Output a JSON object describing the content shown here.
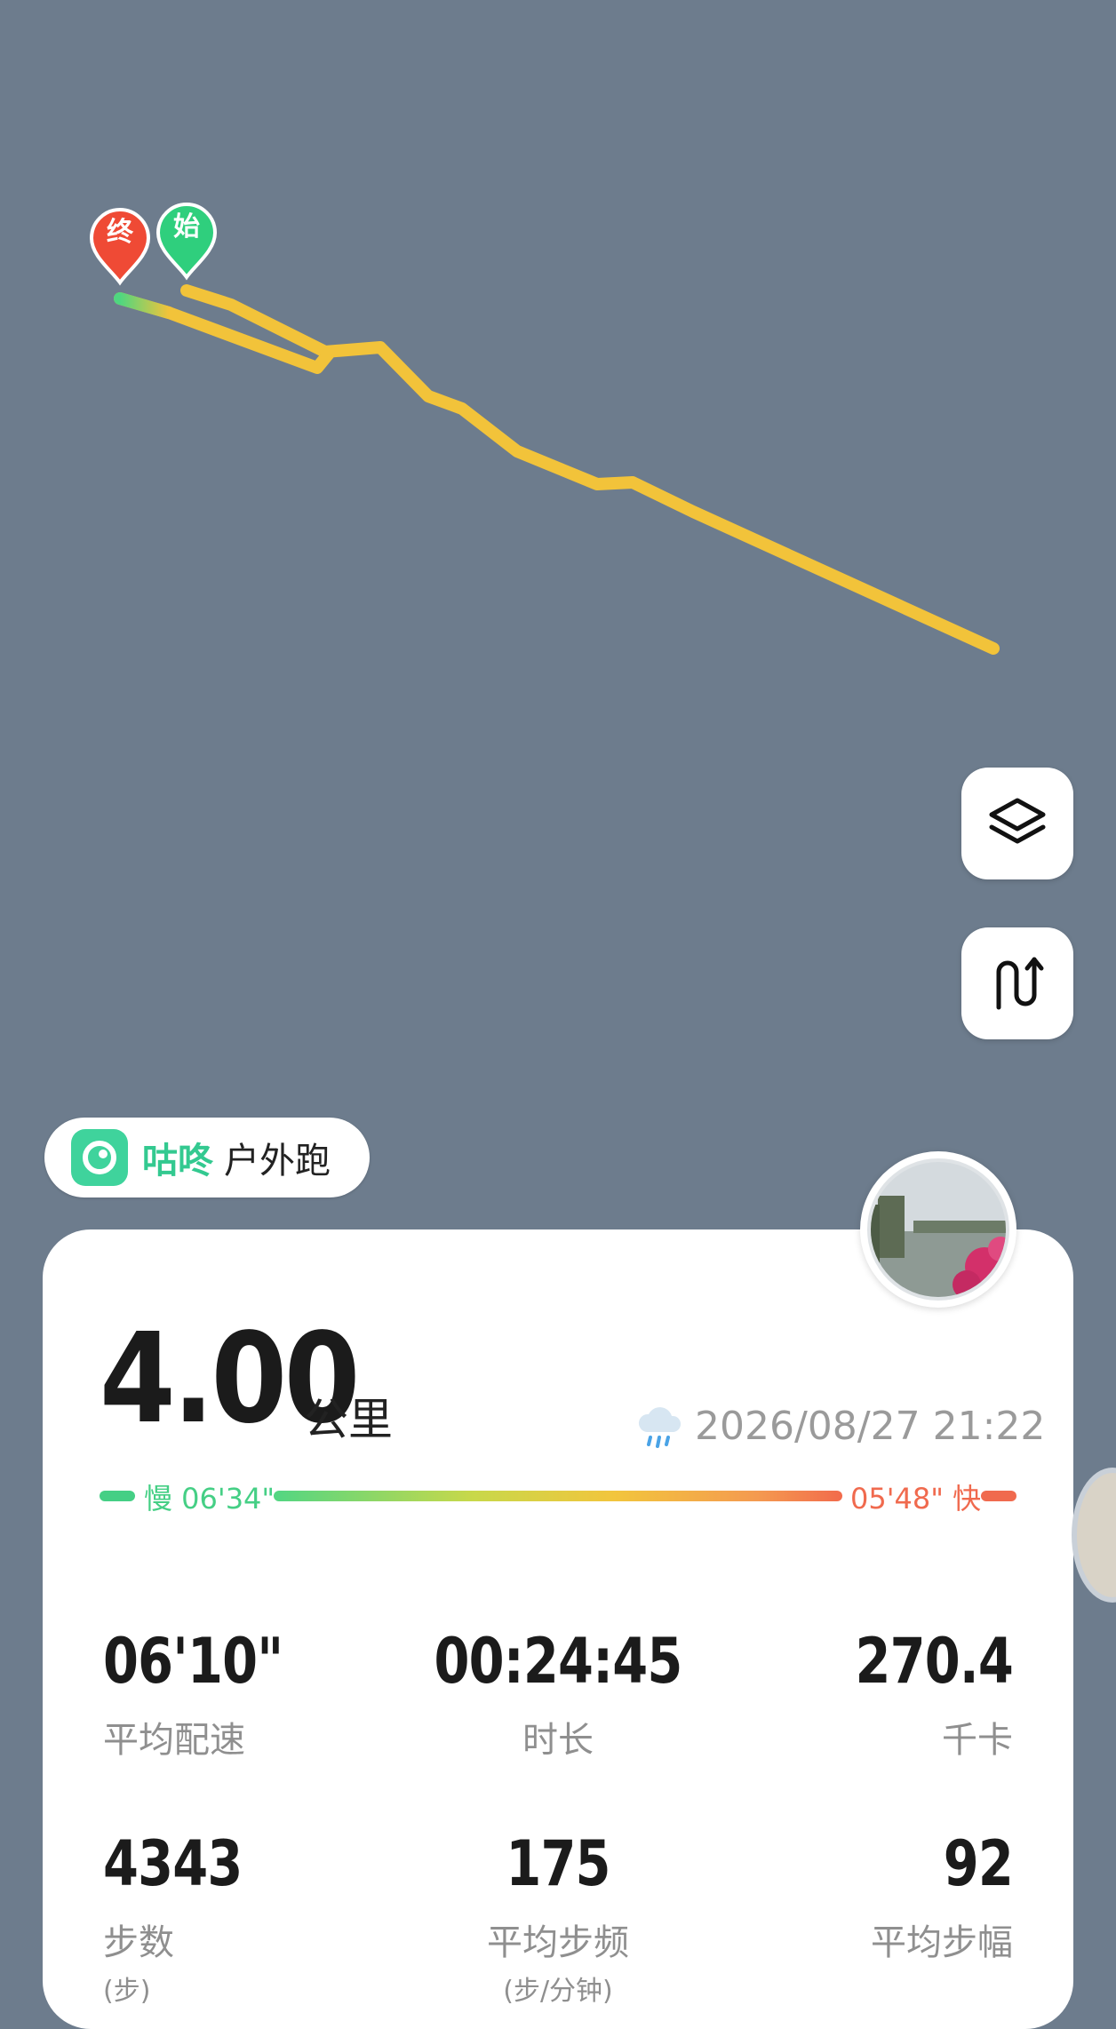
{
  "map": {
    "end_marker": "终",
    "start_marker": "始",
    "route_color": "#f2c33a",
    "route_start_color": "#4fd680",
    "layers_button_icon": "layers-icon",
    "route_button_icon": "route-icon"
  },
  "app": {
    "name": "咕咚",
    "activity": "户外跑",
    "accent_color": "#33c990"
  },
  "summary": {
    "distance": "4.00",
    "distance_unit": "公里",
    "weather_icon": "rain-cloud-icon",
    "datetime": "2026/08/27 21:22"
  },
  "pace_range": {
    "slow_label": "慢 06'34\"",
    "fast_label": "05'48\" 快",
    "slow_color": "#45cf85",
    "fast_color": "#f06a4e"
  },
  "stats": [
    {
      "value": "06'10\"",
      "label": "平均配速"
    },
    {
      "value": "00:24:45",
      "label": "时长"
    },
    {
      "value": "270.4",
      "label": "千卡"
    },
    {
      "value": "4343",
      "label": "步数",
      "unit": "(步)"
    },
    {
      "value": "175",
      "label": "平均步频",
      "unit": "(步/分钟)"
    },
    {
      "value": "92",
      "label": "平均步幅"
    }
  ]
}
